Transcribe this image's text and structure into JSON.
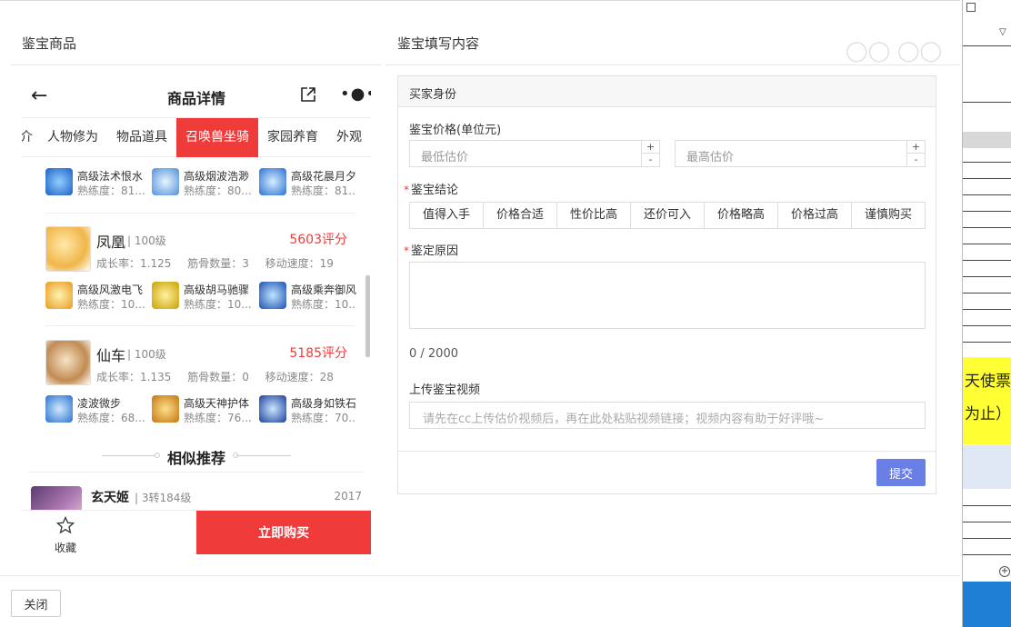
{
  "left_section": {
    "title": "鉴宝商品"
  },
  "right_section": {
    "title": "鉴宝填写内容"
  },
  "phone": {
    "title": "商品详情",
    "tabs": [
      {
        "label": "介"
      },
      {
        "label": "人物修为"
      },
      {
        "label": "物品道具"
      },
      {
        "label": "召唤兽坐骑",
        "active": true
      },
      {
        "label": "家园养育"
      },
      {
        "label": "外观"
      }
    ],
    "top_skills": [
      {
        "name": "高级法术恨水",
        "prof": "熟练度：81..."
      },
      {
        "name": "高级烟波浩渺",
        "prof": "熟练度：80..."
      },
      {
        "name": "高级花晨月夕",
        "prof": "熟练度：81..."
      }
    ],
    "pets": [
      {
        "name": "凤凰",
        "level": "| 100级",
        "score": "5603评分",
        "stats": [
          "成长率：1.125",
          "筋骨数量：3",
          "移动速度：19"
        ],
        "skills": [
          {
            "name": "高级风激电飞",
            "prof": "熟练度：10..."
          },
          {
            "name": "高级胡马驰骤",
            "prof": "熟练度：10..."
          },
          {
            "name": "高级乘奔御风",
            "prof": "熟练度：10..."
          }
        ]
      },
      {
        "name": "仙车",
        "level": "| 100级",
        "score": "5185评分",
        "stats": [
          "成长率：1.135",
          "筋骨数量：0",
          "移动速度：28"
        ],
        "skills": [
          {
            "name": "凌波微步",
            "prof": "熟练度：68..."
          },
          {
            "name": "高级天神护体",
            "prof": "熟练度：76..."
          },
          {
            "name": "高级身如铁石",
            "prof": "熟练度：70..."
          }
        ]
      }
    ],
    "similar_title": "相似推荐",
    "recommend": {
      "name": "玄天姬",
      "level": "| 3转184级",
      "year": "2017"
    },
    "fav_label": "收藏",
    "buy_label": "立即购买"
  },
  "form": {
    "header": "买家身份",
    "price_label": "鉴宝价格(单位元)",
    "min_placeholder": "最低估价",
    "max_placeholder": "最高估价",
    "spin_plus": "+",
    "spin_minus": "-",
    "conclusion_label": "鉴宝结论",
    "conclusion_options": [
      "值得入手",
      "价格合适",
      "性价比高",
      "还价可入",
      "价格略高",
      "价格过高",
      "谨慎购买"
    ],
    "reason_label": "鉴定原因",
    "counter": "0 / 2000",
    "video_label": "上传鉴宝视频",
    "video_placeholder": "请先在cc上传估价视频后，再在此处粘贴视频链接；视频内容有助于好评哦~",
    "submit_label": "提交"
  },
  "footer": {
    "close_label": "关闭"
  },
  "bg_window": {
    "line1": "天使票",
    "line2": "为止）"
  },
  "colors": {
    "accent_red": "#f03b3b",
    "submit_blue": "#6a7fe6"
  }
}
